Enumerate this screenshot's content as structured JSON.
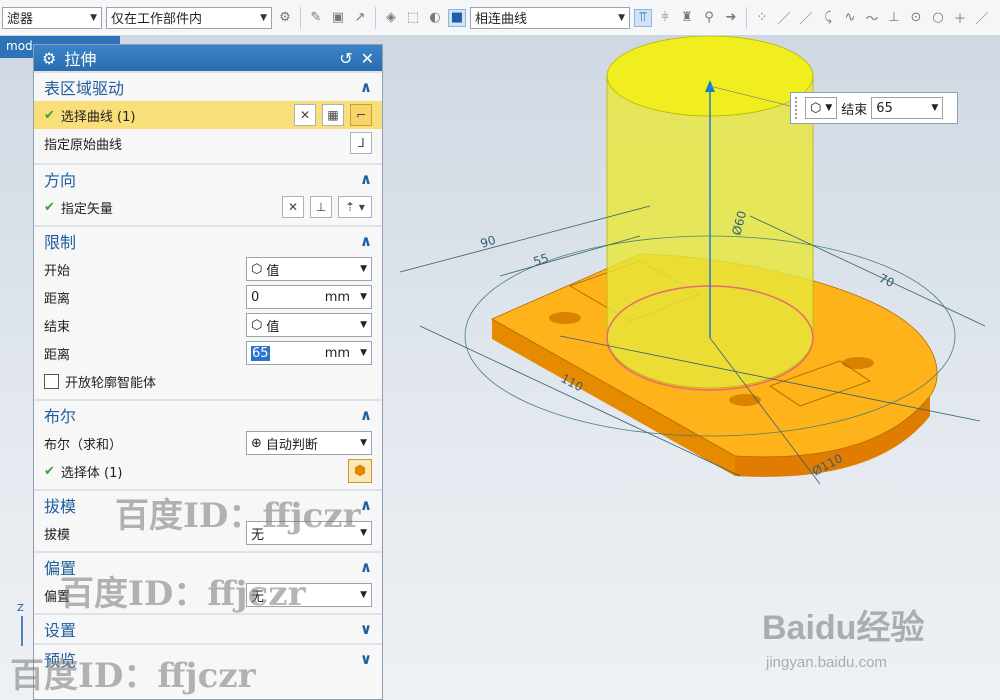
{
  "toolbar": {
    "filter_label": "滤器",
    "scope_value": "仅在工作部件内",
    "curve_rule": "相连曲线"
  },
  "tab": {
    "label": "mod"
  },
  "dialog": {
    "title": "拉伸",
    "sections": {
      "section_area": "表区域驱动",
      "direction": "方向",
      "limits": "限制",
      "boolean": "布尔",
      "draft": "拔模",
      "offset": "偏置",
      "settings": "设置",
      "preview": "预览"
    },
    "select_curve": "选择曲线 (1)",
    "specify_origin_curve": "指定原始曲线",
    "specify_vector": "指定矢量",
    "start_label": "开始",
    "start_value": "值",
    "distance_label": "距离",
    "start_distance": "0",
    "end_label": "结束",
    "end_value": "值",
    "end_distance": "65",
    "unit": "mm",
    "open_profile": "开放轮廓智能体",
    "boolean_label": "布尔（求和）",
    "boolean_value": "自动判断",
    "select_body": "选择体 (1)",
    "draft_label": "拔模",
    "draft_value": "无",
    "offset_label": "偏置",
    "offset_value": "无"
  },
  "popup": {
    "label": "结束",
    "value": "65"
  },
  "dimensions": [
    "90",
    "55",
    "70",
    "110",
    "Ø110",
    "Ø60"
  ],
  "watermarks": {
    "id_text": "百度ID：ffjczr",
    "brand": "Baidu经验",
    "url": "jingyan.baidu.com"
  }
}
